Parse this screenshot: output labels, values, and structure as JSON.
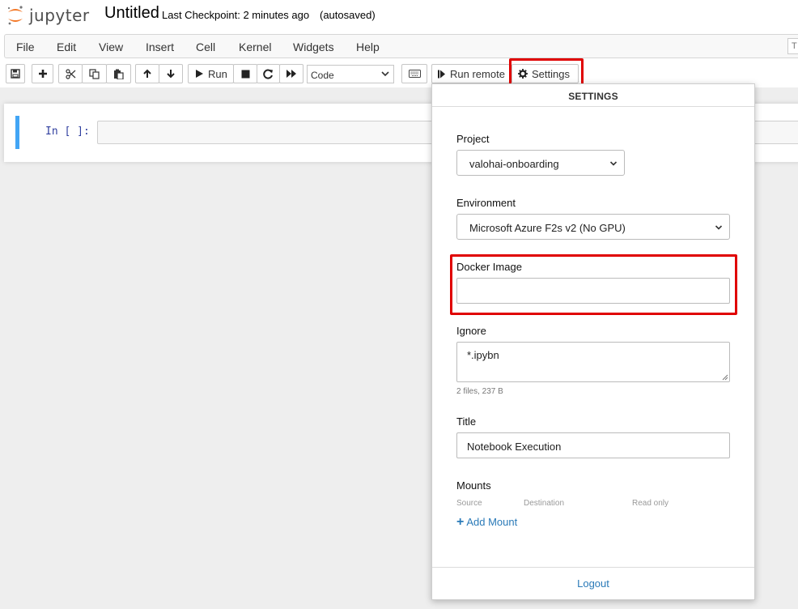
{
  "header": {
    "logo_text": "jupyter",
    "notebook_name": "Untitled",
    "checkpoint": "Last Checkpoint: 2 minutes ago",
    "autosave": "(autosaved)",
    "trusted_badge": "T"
  },
  "menu": [
    "File",
    "Edit",
    "View",
    "Insert",
    "Cell",
    "Kernel",
    "Widgets",
    "Help"
  ],
  "toolbar": {
    "run_label": "Run",
    "cell_type": "Code",
    "run_remote_label": "Run remote",
    "settings_label": "Settings"
  },
  "cell": {
    "prompt": "In [ ]:"
  },
  "settings_panel": {
    "title": "SETTINGS",
    "project_label": "Project",
    "project_value": "valohai-onboarding",
    "environment_label": "Environment",
    "environment_value": "Microsoft Azure F2s v2 (No GPU)",
    "docker_image_label": "Docker Image",
    "docker_image_value": "",
    "ignore_label": "Ignore",
    "ignore_value": "*.ipybn",
    "ignore_hint": "2 files, 237 B",
    "title_label": "Title",
    "title_value": "Notebook Execution",
    "mounts_label": "Mounts",
    "mount_columns": [
      "Source",
      "Destination",
      "Read only"
    ],
    "add_mount_label": "Add Mount",
    "logout_label": "Logout"
  },
  "colors": {
    "highlight": "#e00000",
    "link": "#2a7ab8",
    "cell_border": "#42a5f5",
    "prompt": "#303f9f",
    "logo_orange": "#f37726"
  }
}
